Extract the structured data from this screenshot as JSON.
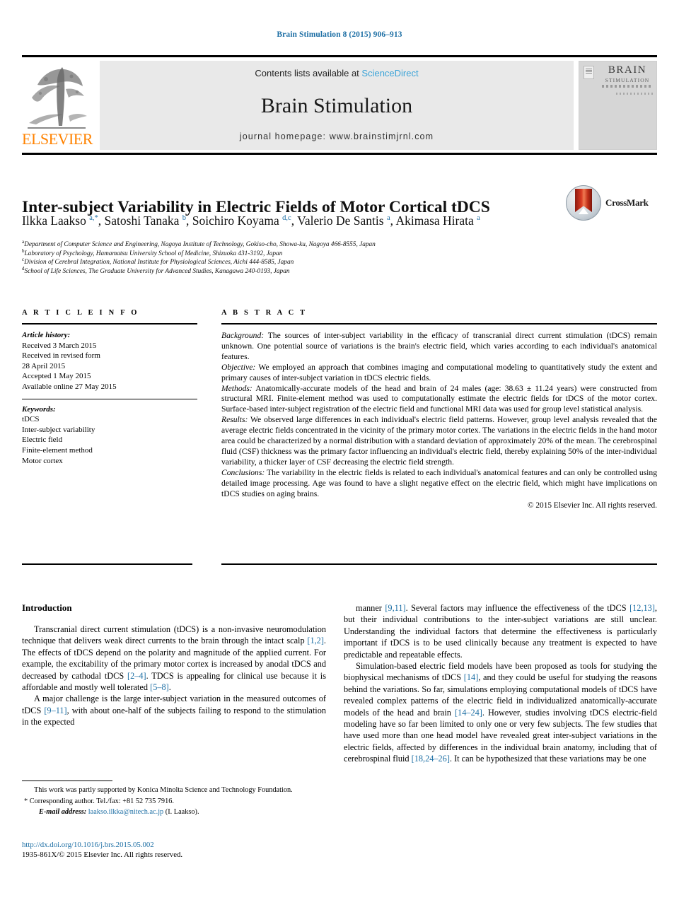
{
  "header": {
    "running_title": "Brain Stimulation 8 (2015) 906–913"
  },
  "masthead": {
    "contents_prefix": "Contents lists available at ",
    "sciencedirect": "ScienceDirect",
    "journal_name": "Brain Stimulation",
    "homepage": "journal homepage: www.brainstimjrnl.com",
    "publisher": "ELSEVIER",
    "cover_title": "BRAIN",
    "cover_subtitle": "STIMULATION",
    "link_color": "#3aa3d8",
    "publisher_color": "#ff8200"
  },
  "article": {
    "title": "Inter-subject Variability in Electric Fields of Motor Cortical tDCS",
    "crossmark_label": "CrossMark",
    "authors_html": "Ilkka Laakso <sup>a,*</sup>, Satoshi Tanaka <sup>b</sup>, Soichiro Koyama <sup>d,c</sup>, Valerio De Santis <sup>a</sup>, Akimasa Hirata <sup>a</sup>",
    "affiliations": [
      {
        "mark": "a",
        "text": "Department of Computer Science and Engineering, Nagoya Institute of Technology, Gokiso-cho, Showa-ku, Nagoya 466-8555, Japan"
      },
      {
        "mark": "b",
        "text": "Laboratory of Psychology, Hamamatsu University School of Medicine, Shizuoka 431-3192, Japan"
      },
      {
        "mark": "c",
        "text": "Division of Cerebral Integration, National Institute for Physiological Sciences, Aichi 444-8585, Japan"
      },
      {
        "mark": "d",
        "text": "School of Life Sciences, The Graduate University for Advanced Studies, Kanagawa 240-0193, Japan"
      }
    ]
  },
  "article_info": {
    "heading": "A R T I C L E  I N F O",
    "history_label": "Article history:",
    "history_lines": [
      "Received 3 March 2015",
      "Received in revised form",
      "28 April 2015",
      "Accepted 1 May 2015",
      "Available online 27 May 2015"
    ],
    "keywords_label": "Keywords:",
    "keywords": [
      "tDCS",
      "Inter-subject variability",
      "Electric field",
      "Finite-element method",
      "Motor cortex"
    ]
  },
  "abstract": {
    "heading": "A B S T R A C T",
    "sections": [
      {
        "label": "Background:",
        "text": " The sources of inter-subject variability in the efficacy of transcranial direct current stimulation (tDCS) remain unknown. One potential source of variations is the brain's electric field, which varies according to each individual's anatomical features."
      },
      {
        "label": "Objective:",
        "text": " We employed an approach that combines imaging and computational modeling to quantitatively study the extent and primary causes of inter-subject variation in tDCS electric fields."
      },
      {
        "label": "Methods:",
        "text": " Anatomically-accurate models of the head and brain of 24 males (age: 38.63 ± 11.24 years) were constructed from structural MRI. Finite-element method was used to computationally estimate the electric fields for tDCS of the motor cortex. Surface-based inter-subject registration of the electric field and functional MRI data was used for group level statistical analysis."
      },
      {
        "label": "Results:",
        "text": " We observed large differences in each individual's electric field patterns. However, group level analysis revealed that the average electric fields concentrated in the vicinity of the primary motor cortex. The variations in the electric fields in the hand motor area could be characterized by a normal distribution with a standard deviation of approximately 20% of the mean. The cerebrospinal fluid (CSF) thickness was the primary factor influencing an individual's electric field, thereby explaining 50% of the inter-individual variability, a thicker layer of CSF decreasing the electric field strength."
      },
      {
        "label": "Conclusions:",
        "text": " The variability in the electric fields is related to each individual's anatomical features and can only be controlled using detailed image processing. Age was found to have a slight negative effect on the electric field, which might have implications on tDCS studies on aging brains."
      }
    ],
    "copyright": "© 2015 Elsevier Inc. All rights reserved."
  },
  "body": {
    "intro_heading": "Introduction",
    "left_paragraphs_html": [
      "Transcranial direct current stimulation (tDCS) is a non-invasive neuromodulation technique that delivers weak direct currents to the brain through the intact scalp <span class=\"ref\">[1,2]</span>. The effects of tDCS depend on the polarity and magnitude of the applied current. For example, the excitability of the primary motor cortex is increased by anodal tDCS and decreased by cathodal tDCS <span class=\"ref\">[2–4]</span>. TDCS is appealing for clinical use because it is affordable and mostly well tolerated <span class=\"ref\">[5–8]</span>.",
      "A major challenge is the large inter-subject variation in the measured outcomes of tDCS <span class=\"ref\">[9–11]</span>, with about one-half of the subjects failing to respond to the stimulation in the expected"
    ],
    "right_paragraphs_html": [
      "manner <span class=\"ref\">[9,11]</span>. Several factors may influence the effectiveness of the tDCS <span class=\"ref\">[12,13]</span>, but their individual contributions to the inter-subject variations are still unclear. Understanding the individual factors that determine the effectiveness is particularly important if tDCS is to be used clinically because any treatment is expected to have predictable and repeatable effects.",
      "Simulation-based electric field models have been proposed as tools for studying the biophysical mechanisms of tDCS <span class=\"ref\">[14]</span>, and they could be useful for studying the reasons behind the variations. So far, simulations employing computational models of tDCS have revealed complex patterns of the electric field in individualized anatomically-accurate models of the head and brain <span class=\"ref\">[14–24]</span>. However, studies involving tDCS electric-field modeling have so far been limited to only one or very few subjects. The few studies that have used more than one head model have revealed great inter-subject variations in the electric fields, affected by differences in the individual brain anatomy, including that of cerebrospinal fluid <span class=\"ref\">[18,24–26]</span>. It can be hypothesized that these variations may be one"
    ]
  },
  "footnotes": {
    "funding": "This work was partly supported by Konica Minolta Science and Technology Foundation.",
    "corresponding": "* Corresponding author. Tel./fax: +81 52 735 7916.",
    "email_label": "E-mail address:",
    "email": "laakso.ilkka@nitech.ac.jp",
    "email_suffix": " (I. Laakso).",
    "doi": "http://dx.doi.org/10.1016/j.brs.2015.05.002",
    "issn_line": "1935-861X/© 2015 Elsevier Inc. All rights reserved.",
    "link_color": "#1c6ea4"
  }
}
